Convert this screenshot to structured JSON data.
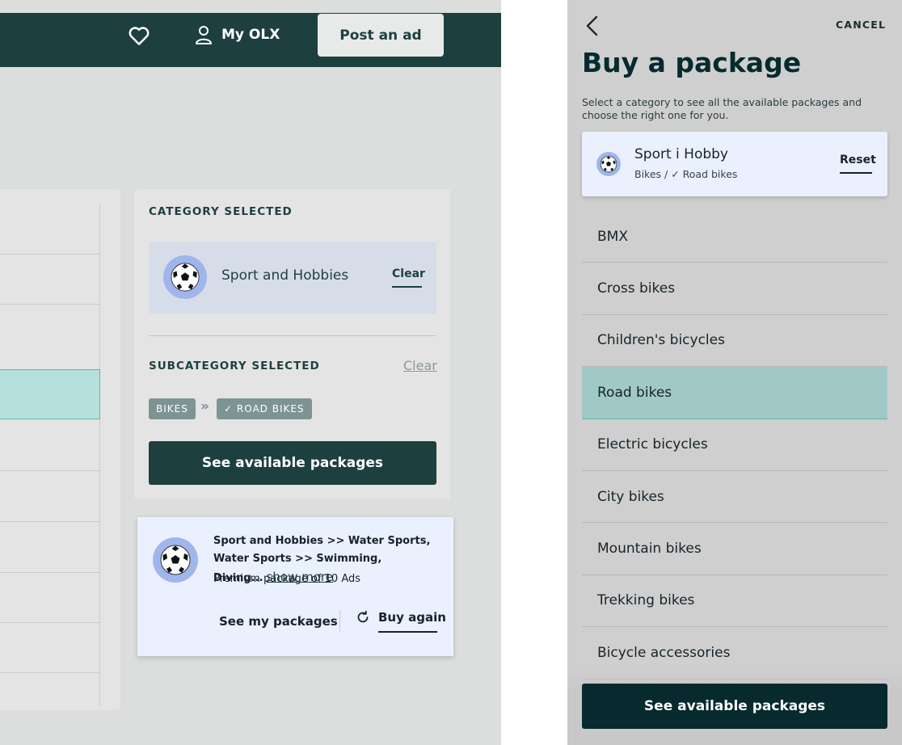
{
  "desktop": {
    "header": {
      "favorites_icon": "heart-icon",
      "account_label": "My OLX",
      "account_icon": "user-icon",
      "post_ad_label": "Post an ad"
    },
    "selection": {
      "category_heading": "CATEGORY SELECTED",
      "category_name": "Sport and Hobbies",
      "category_icon": "soccer-ball-icon",
      "category_clear": "Clear",
      "subcategory_heading": "SUBCATEGORY SELECTED",
      "subcategory_clear": "Clear",
      "chips": [
        "BIKES",
        "✓ ROAD BIKES"
      ],
      "chip_separator": "»",
      "see_packages_label": "See available packages"
    },
    "history": {
      "path": "Sport and Hobbies >> Water Sports, Water Sports >> Swimming, Diving...",
      "show_more": "show more",
      "description": "Premium package of 10 Ads",
      "see_my_packages": "See my packages",
      "buy_again": "Buy again",
      "buy_again_icon": "refresh-icon"
    }
  },
  "mobile": {
    "cancel_label": "CANCEL",
    "title": "Buy a package",
    "subtitle": "Select a category to see all the available packages and choose the right one for you.",
    "selected": {
      "name": "Sport i Hobby",
      "crumb": "Bikes / ✓ Road bikes",
      "reset_label": "Reset"
    },
    "items": [
      "BMX",
      "Cross bikes",
      "Children's bicycles",
      "Road bikes",
      "Electric bicycles",
      "City bikes",
      "Mountain bikes",
      "Trekking bikes",
      "Bicycle accessories"
    ],
    "selected_index": 3,
    "see_packages_label": "See available packages"
  },
  "colors": {
    "brand_dark": "#1d3f40",
    "accent_teal": "#57b9b1",
    "selected_row": "#9fc8c6",
    "card_blue": "#eaf0fe"
  }
}
